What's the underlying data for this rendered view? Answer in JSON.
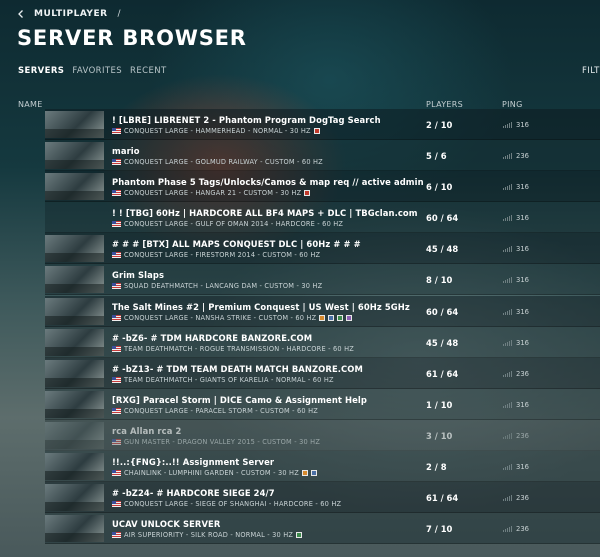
{
  "breadcrumb": {
    "section": "MULTIPLAYER",
    "separator": "/"
  },
  "title": "SERVER BROWSER",
  "tabs": [
    {
      "label": "SERVERS"
    },
    {
      "label": "FAVORITES"
    },
    {
      "label": "RECENT"
    }
  ],
  "filter_label": "FILTER",
  "columns": {
    "name": "NAME",
    "players": "PLAYERS",
    "ping": "PING"
  },
  "servers": [
    {
      "name": "! [LBRE] LIBRENET 2 - Phantom Program DogTag Search",
      "meta": "CONQUEST LARGE - HAMMERHEAD - NORMAL - 30 HZ",
      "players": "2 / 10",
      "ping": "316",
      "badges": [
        "#c0392b"
      ],
      "thumb": true
    },
    {
      "name": "mario",
      "meta": "CONQUEST LARGE - GOLMUD RAILWAY - CUSTOM - 60 HZ",
      "players": "5 / 6",
      "ping": "236",
      "badges": [],
      "thumb": true
    },
    {
      "name": "Phantom Phase 5 Tags/Unlocks/Camos & map req // active admin",
      "meta": "CONQUEST LARGE - HANGAR 21 - CUSTOM - 30 HZ",
      "players": "6 / 10",
      "ping": "316",
      "badges": [
        "#c0392b"
      ],
      "thumb": true
    },
    {
      "name": "! ! [TBG] 60Hz | HARDCORE ALL BF4 MAPS + DLC | TBGclan.com",
      "meta": "CONQUEST LARGE - GULF OF OMAN 2014 - HARDCORE - 60 HZ",
      "players": "60 / 64",
      "ping": "316",
      "badges": [],
      "thumb": false
    },
    {
      "name": "# # # [BTX] ALL MAPS CONQUEST DLC | 60Hz # # #",
      "meta": "CONQUEST LARGE - FIRESTORM 2014 - CUSTOM - 60 HZ",
      "players": "45 / 48",
      "ping": "316",
      "badges": [],
      "thumb": true
    },
    {
      "name": "Grim Slaps",
      "meta": "SQUAD DEATHMATCH - LANCANG DAM - CUSTOM - 30 HZ",
      "players": "8 / 10",
      "ping": "316",
      "badges": [],
      "thumb": true
    },
    {
      "name": "The Salt Mines #2 | Premium Conquest | US West | 60Hz 5GHz",
      "meta": "CONQUEST LARGE - NANSHA STRIKE - CUSTOM - 60 HZ",
      "players": "60 / 64",
      "ping": "316",
      "badges": [
        "#d68a2e",
        "#4a6fa5",
        "#3d8b4d",
        "#8a5fb0"
      ],
      "thumb": true
    },
    {
      "name": "# -bZ6- # TDM HARDCORE BANZORE.COM",
      "meta": "TEAM DEATHMATCH - ROGUE TRANSMISSION - HARDCORE - 60 HZ",
      "players": "45 / 48",
      "ping": "316",
      "badges": [],
      "thumb": true
    },
    {
      "name": "# -bZ13- # TDM TEAM DEATH MATCH BANZORE.COM",
      "meta": "TEAM DEATHMATCH - GIANTS OF KARELIA - NORMAL - 60 HZ",
      "players": "61 / 64",
      "ping": "236",
      "badges": [],
      "thumb": true
    },
    {
      "name": "[RXG] Paracel Storm | DICE Camo & Assignment Help",
      "meta": "CONQUEST LARGE - PARACEL STORM - CUSTOM - 60 HZ",
      "players": "1 / 10",
      "ping": "316",
      "badges": [],
      "thumb": true
    },
    {
      "name": "rca Allan rca 2",
      "meta": "GUN MASTER - DRAGON VALLEY 2015 - CUSTOM - 30 HZ",
      "players": "3 / 10",
      "ping": "236",
      "badges": [],
      "thumb": true,
      "dim": true
    },
    {
      "name": "!!..:{FNG}:..!! Assignment Server",
      "meta": "CHAINLINK - LUMPHINI GARDEN - CUSTOM - 30 HZ",
      "players": "2 / 8",
      "ping": "316",
      "badges": [
        "#d68a2e",
        "#4a6fa5"
      ],
      "thumb": true
    },
    {
      "name": "# -bZ24- # HARDCORE SIEGE 24/7",
      "meta": "CONQUEST LARGE - SIEGE OF SHANGHAI - HARDCORE - 60 HZ",
      "players": "61 / 64",
      "ping": "236",
      "badges": [],
      "thumb": true
    },
    {
      "name": "UCAV UNLOCK SERVER",
      "meta": "AIR SUPERIORITY - SILK ROAD - NORMAL - 30 HZ",
      "players": "7 / 10",
      "ping": "236",
      "badges": [
        "#3d8b4d"
      ],
      "thumb": true
    }
  ]
}
